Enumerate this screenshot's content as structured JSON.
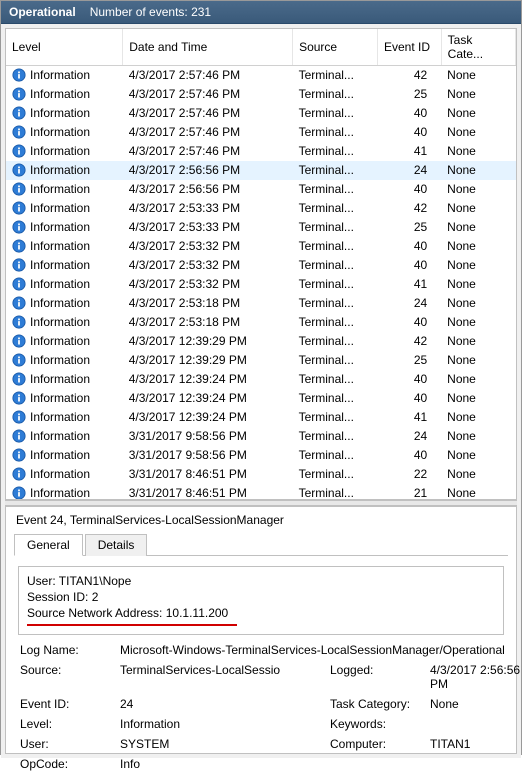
{
  "titlebar": {
    "title": "Operational",
    "subtitle": "Number of events: 231"
  },
  "columns": {
    "level": "Level",
    "date": "Date and Time",
    "source": "Source",
    "eventid": "Event ID",
    "task": "Task Cate..."
  },
  "level_label": "Information",
  "source_label": "Terminal...",
  "task_label": "None",
  "events": [
    {
      "date": "4/3/2017 2:57:46 PM",
      "eid": "42",
      "sel": false
    },
    {
      "date": "4/3/2017 2:57:46 PM",
      "eid": "25",
      "sel": false
    },
    {
      "date": "4/3/2017 2:57:46 PM",
      "eid": "40",
      "sel": false
    },
    {
      "date": "4/3/2017 2:57:46 PM",
      "eid": "40",
      "sel": false
    },
    {
      "date": "4/3/2017 2:57:46 PM",
      "eid": "41",
      "sel": false
    },
    {
      "date": "4/3/2017 2:56:56 PM",
      "eid": "24",
      "sel": true
    },
    {
      "date": "4/3/2017 2:56:56 PM",
      "eid": "40",
      "sel": false
    },
    {
      "date": "4/3/2017 2:53:33 PM",
      "eid": "42",
      "sel": false
    },
    {
      "date": "4/3/2017 2:53:33 PM",
      "eid": "25",
      "sel": false
    },
    {
      "date": "4/3/2017 2:53:32 PM",
      "eid": "40",
      "sel": false
    },
    {
      "date": "4/3/2017 2:53:32 PM",
      "eid": "40",
      "sel": false
    },
    {
      "date": "4/3/2017 2:53:32 PM",
      "eid": "41",
      "sel": false
    },
    {
      "date": "4/3/2017 2:53:18 PM",
      "eid": "24",
      "sel": false
    },
    {
      "date": "4/3/2017 2:53:18 PM",
      "eid": "40",
      "sel": false
    },
    {
      "date": "4/3/2017 12:39:29 PM",
      "eid": "42",
      "sel": false
    },
    {
      "date": "4/3/2017 12:39:29 PM",
      "eid": "25",
      "sel": false
    },
    {
      "date": "4/3/2017 12:39:24 PM",
      "eid": "40",
      "sel": false
    },
    {
      "date": "4/3/2017 12:39:24 PM",
      "eid": "40",
      "sel": false
    },
    {
      "date": "4/3/2017 12:39:24 PM",
      "eid": "41",
      "sel": false
    },
    {
      "date": "3/31/2017 9:58:56 PM",
      "eid": "24",
      "sel": false
    },
    {
      "date": "3/31/2017 9:58:56 PM",
      "eid": "40",
      "sel": false
    },
    {
      "date": "3/31/2017 8:46:51 PM",
      "eid": "22",
      "sel": false
    },
    {
      "date": "3/31/2017 8:46:51 PM",
      "eid": "21",
      "sel": false
    }
  ],
  "detail": {
    "heading": "Event 24, TerminalServices-LocalSessionManager",
    "tab_general": "General",
    "tab_details": "Details",
    "user_line": "User: TITAN1\\Nope",
    "session_line": "Session ID: 2",
    "source_addr_line": "Source Network Address: 10.1.11.200",
    "labels": {
      "logname": "Log Name:",
      "source": "Source:",
      "eventid": "Event ID:",
      "level": "Level:",
      "user": "User:",
      "opcode": "OpCode:",
      "logged": "Logged:",
      "taskcat": "Task Category:",
      "keywords": "Keywords:",
      "computer": "Computer:"
    },
    "values": {
      "logname": "Microsoft-Windows-TerminalServices-LocalSessionManager/Operational",
      "source": "TerminalServices-LocalSessio",
      "eventid": "24",
      "level": "Information",
      "user": "SYSTEM",
      "opcode": "Info",
      "logged": "4/3/2017 2:56:56 PM",
      "taskcat": "None",
      "keywords": "",
      "computer": "TITAN1"
    }
  }
}
